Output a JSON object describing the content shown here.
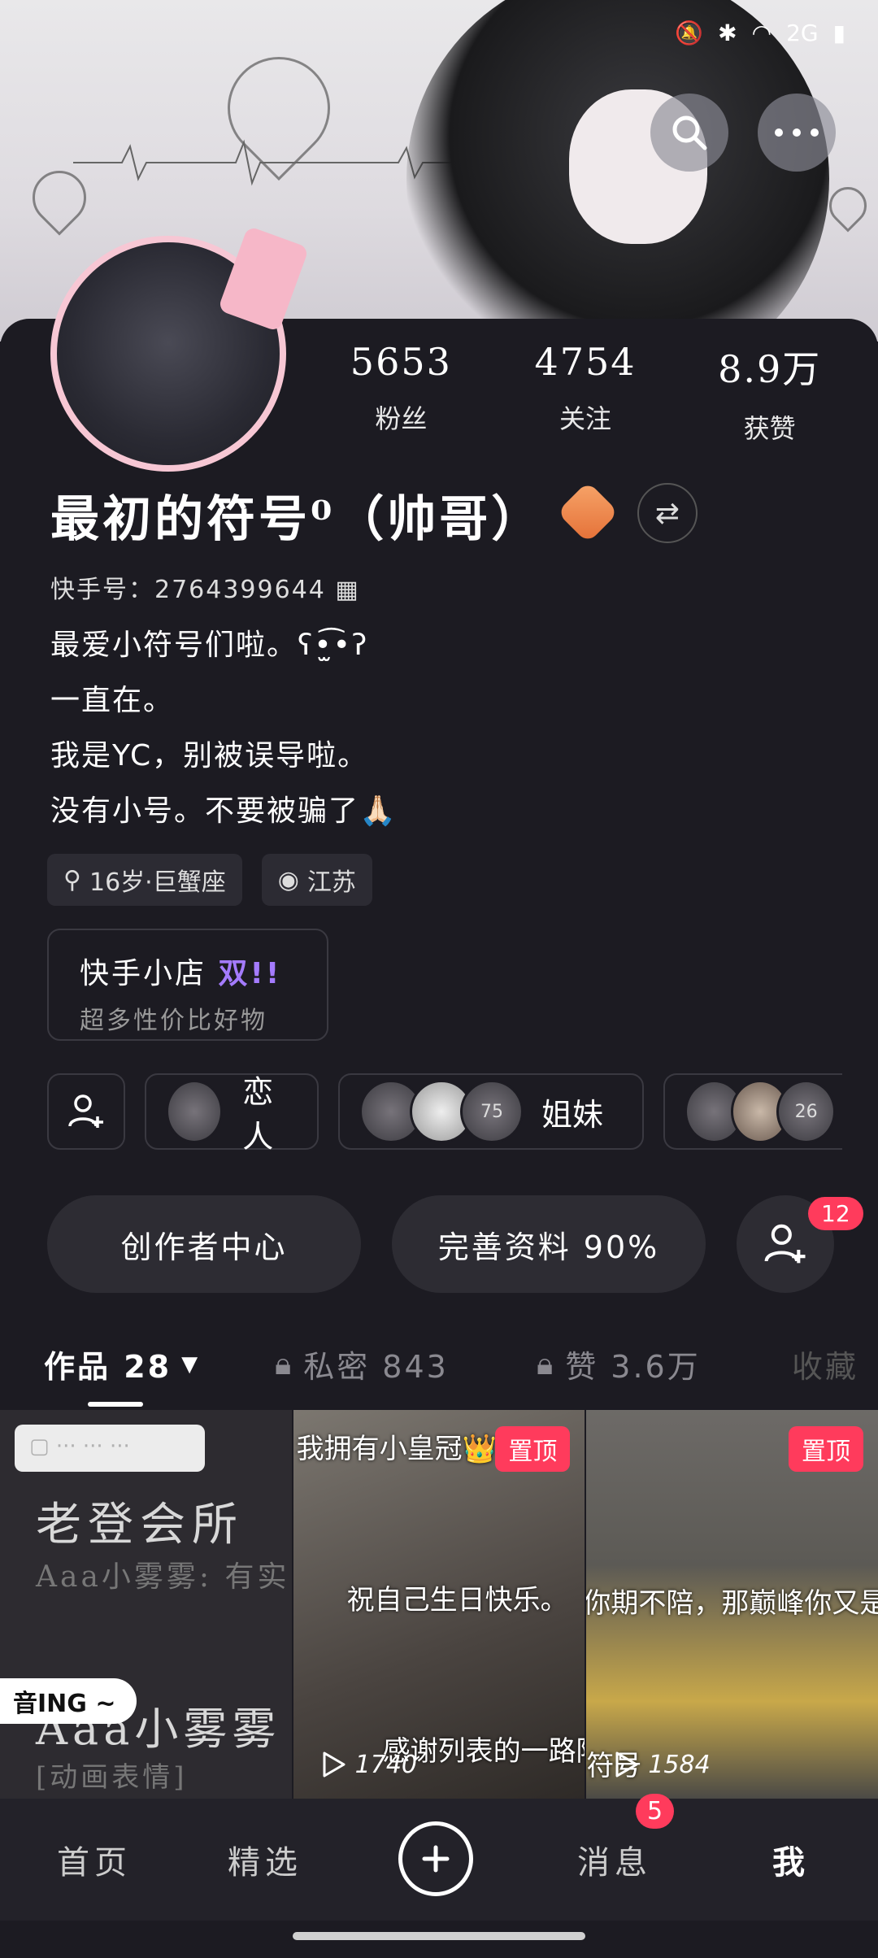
{
  "status_bar": {
    "network": "2G"
  },
  "profile": {
    "stats": [
      {
        "value": "5653",
        "label": "粉丝"
      },
      {
        "value": "4754",
        "label": "关注"
      },
      {
        "value": "8.9万",
        "label": "获赞"
      }
    ],
    "name": "最初的符号⁰（帅哥）",
    "kuaishou_id": "快手号：2764399644",
    "bio": [
      "最爱小符号们啦。ʕ•̫͡•ʔ",
      "一直在。",
      "我是YC，别被误导啦。",
      "没有小号。不要被骗了🙏🏻"
    ],
    "tags": [
      "16岁·巨蟹座",
      "江苏"
    ]
  },
  "shop": {
    "title": "快手小店",
    "badge": "双!!",
    "subtitle": "超多性价比好物"
  },
  "relations": [
    {
      "label": "恋人",
      "extra": ""
    },
    {
      "label": "姐妹",
      "extra": "75"
    },
    {
      "label": "",
      "extra": "26"
    }
  ],
  "actions": {
    "creator": "创作者中心",
    "complete": "完善资料 90%",
    "friends_badge": "12"
  },
  "tabs": {
    "works": "作品 28",
    "private": "私密 843",
    "likes": "赞 3.6万",
    "favorites": "收藏"
  },
  "grid": {
    "cell1": {
      "title": "老登会所",
      "sub": "Aaa小雾雾: 有实",
      "name": "Aaa小雾雾",
      "tag": "[动画表情]",
      "bubble": "音ING ~"
    },
    "cell2": {
      "caption_top": "我拥有小皇冠👑啦",
      "caption_mid": "祝自己生日快乐。",
      "caption_bottom": "感谢列表的一路陪伴",
      "pin": "置顶",
      "plays": "1740"
    },
    "cell3": {
      "caption_mid": "你期不陪，那巅峰你又是谁",
      "caption_bottom": "符号",
      "pin": "置顶",
      "plays": "1584"
    }
  },
  "nav": {
    "home": "首页",
    "featured": "精选",
    "messages": "消息",
    "messages_badge": "5",
    "me": "我"
  },
  "colors": {
    "accent_pink": "#ff3b5c",
    "background": "#1c1b22",
    "shop_badge": "#a47bff"
  }
}
